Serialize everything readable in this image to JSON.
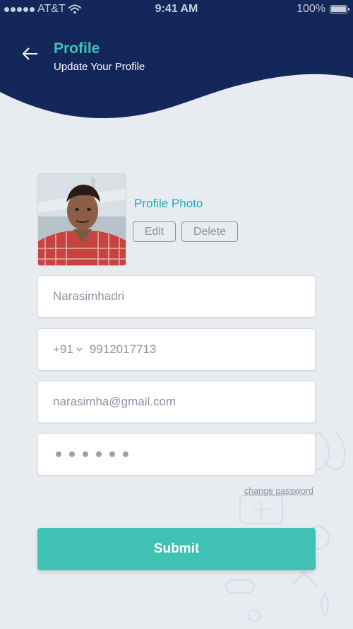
{
  "colors": {
    "header_bg": "#14275a",
    "accent_teal": "#3fc1b4",
    "link_blue": "#23a8b8",
    "page_bg": "#e8ecf1"
  },
  "status_bar": {
    "carrier": "AT&T",
    "time": "9:41 AM",
    "battery": "100%",
    "battery_level": 1.0
  },
  "header": {
    "title": "Profile",
    "subtitle": "Update Your Profile",
    "back_icon": "arrow-left-icon"
  },
  "profile_photo": {
    "label": "Profile Photo",
    "edit_label": "Edit",
    "delete_label": "Delete"
  },
  "form": {
    "name_value": "Narasimhadri",
    "country_code": "+91",
    "phone_value": "9912017713",
    "email_value": "narasimha@gmail.com",
    "password_mask_count": 6
  },
  "links": {
    "change_password": "change password"
  },
  "submit_label": "Submit"
}
